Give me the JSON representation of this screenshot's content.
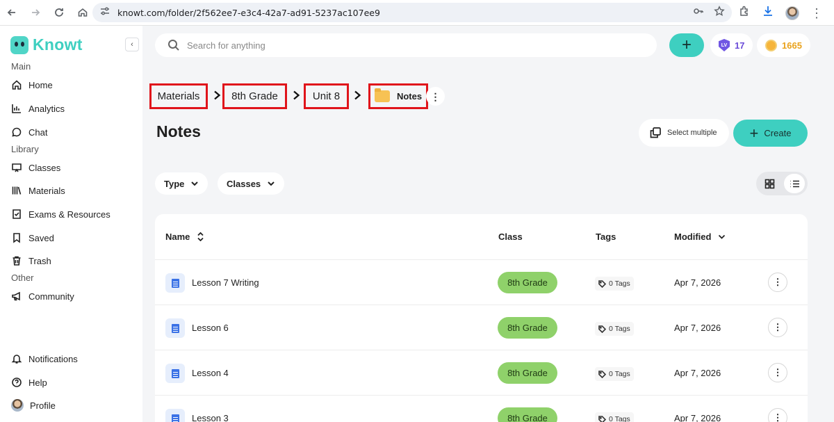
{
  "browser": {
    "url": "knowt.com/folder/2f562ee7-e3c4-42a7-ad91-5237ac107ee9",
    "icons": [
      "back-icon",
      "forward-icon",
      "reload-icon",
      "home-icon",
      "site-settings-icon",
      "password-key-icon",
      "bookmark-star-icon",
      "extensions-icon",
      "downloads-icon",
      "profile-avatar",
      "more-icon"
    ]
  },
  "sidebar": {
    "brand": "Knowt",
    "sections": {
      "main": "Main",
      "library": "Library",
      "other": "Other"
    },
    "items": {
      "home": "Home",
      "analytics": "Analytics",
      "chat": "Chat",
      "classes": "Classes",
      "materials": "Materials",
      "exams": "Exams & Resources",
      "saved": "Saved",
      "trash": "Trash",
      "community": "Community",
      "notifications": "Notifications",
      "help": "Help",
      "profile": "Profile"
    }
  },
  "header": {
    "search_placeholder": "Search for anything",
    "level": "17",
    "level_badge": "LV",
    "coins": "1665"
  },
  "breadcrumb": [
    "Materials",
    "8th Grade",
    "Unit 8",
    "Notes"
  ],
  "page": {
    "title": "Notes",
    "select_multiple": "Select multiple",
    "create": "Create"
  },
  "filters": {
    "type": "Type",
    "classes": "Classes"
  },
  "table": {
    "headers": {
      "name": "Name",
      "class": "Class",
      "tags": "Tags",
      "modified": "Modified"
    },
    "rows": [
      {
        "name": "Lesson 7 Writing",
        "class": "8th Grade",
        "tags": "0 Tags",
        "modified": "Apr 7, 2026"
      },
      {
        "name": "Lesson 6",
        "class": "8th Grade",
        "tags": "0 Tags",
        "modified": "Apr 7, 2026"
      },
      {
        "name": "Lesson 4",
        "class": "8th Grade",
        "tags": "0 Tags",
        "modified": "Apr 7, 2026"
      },
      {
        "name": "Lesson 3",
        "class": "8th Grade",
        "tags": "0 Tags",
        "modified": "Apr 7, 2026"
      }
    ]
  },
  "colors": {
    "accent": "#3ecfc0",
    "class_badge": "#8fd16a",
    "highlight_border": "#e0141b",
    "level": "#6a4bd8",
    "coins": "#e9a21c"
  }
}
